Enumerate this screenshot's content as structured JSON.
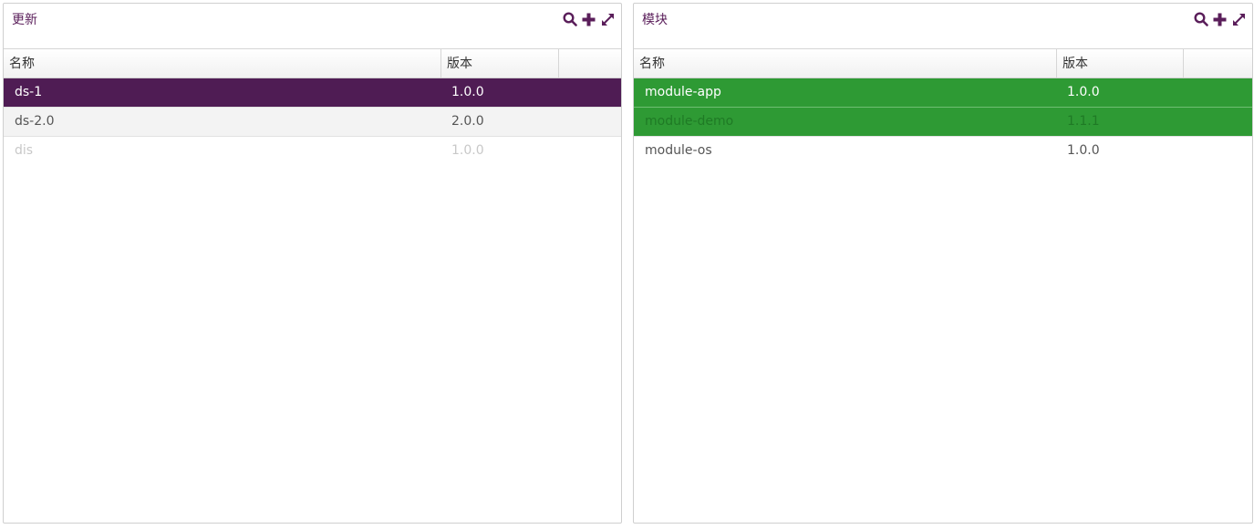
{
  "colors": {
    "accent": "#5a1e5a",
    "selected_purple": "#4f1c54",
    "selected_green": "#2e9a34",
    "text": "#555555",
    "disabled_text": "#c8c8c8"
  },
  "panels": [
    {
      "title": "更新",
      "toolbar": {
        "search_icon": "search-icon",
        "add_icon": "plus-icon",
        "expand_icon": "expand-icon"
      },
      "columns": [
        "名称",
        "版本",
        ""
      ],
      "rows": [
        {
          "name": "ds-1",
          "version": "1.0.0",
          "state": "selected"
        },
        {
          "name": "ds-2.0",
          "version": "2.0.0",
          "state": "hover"
        },
        {
          "name": "dis",
          "version": "1.0.0",
          "state": "disabled"
        }
      ]
    },
    {
      "title": "模块",
      "toolbar": {
        "search_icon": "search-icon",
        "add_icon": "plus-icon",
        "expand_icon": "expand-icon"
      },
      "columns": [
        "名称",
        "版本",
        ""
      ],
      "rows": [
        {
          "name": "module-app",
          "version": "1.0.0",
          "state": "selected-green"
        },
        {
          "name": "module-demo",
          "version": "1.1.1",
          "state": "selected-green-dim"
        },
        {
          "name": "module-os",
          "version": "1.0.0",
          "state": "normal"
        }
      ]
    }
  ]
}
